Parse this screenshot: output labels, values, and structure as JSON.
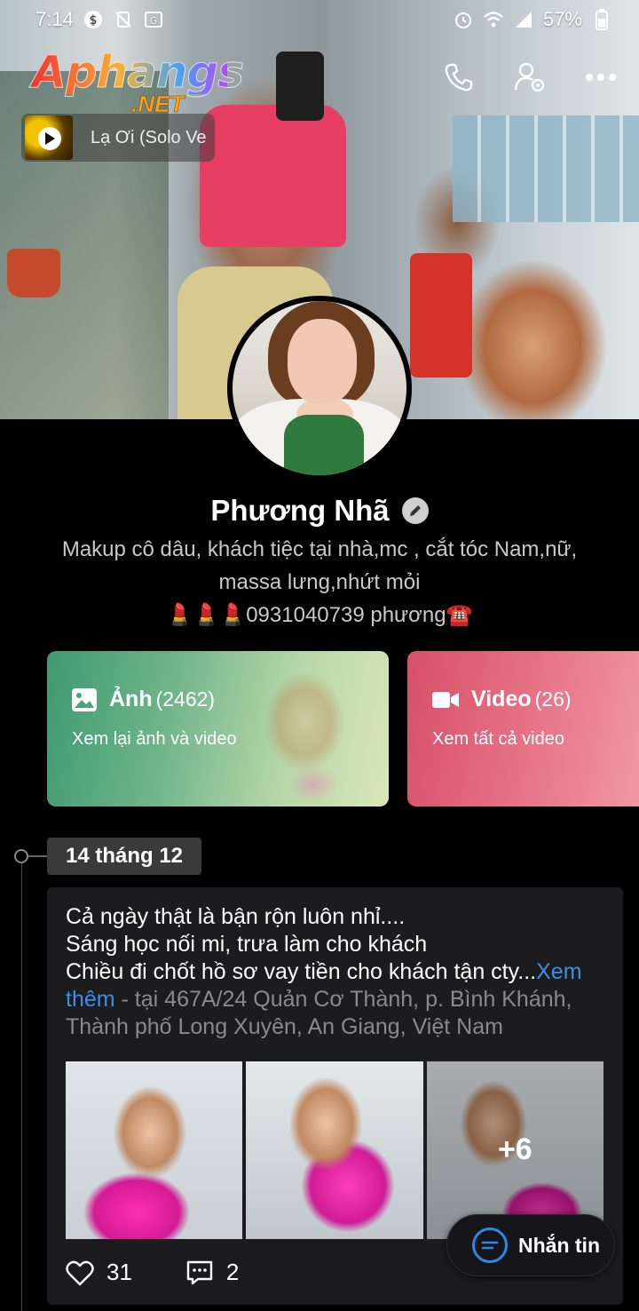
{
  "status_bar": {
    "time": "7:14",
    "battery": "57%"
  },
  "logo": {
    "main": "Aphangs",
    "sub": ".NET"
  },
  "music": {
    "title": "Lạ Ơi (Solo Ve"
  },
  "profile": {
    "name": "Phương Nhã",
    "bio_line1": "Makup cô dâu, khách tiệc tại nhà,mc , cắt tóc Nam,nữ,",
    "bio_line2": "massa lưng,nhứt mỏi",
    "bio_line3": "💄💄💄0931040739 phương☎️"
  },
  "cards": {
    "photos": {
      "title": "Ảnh",
      "count": "(2462)",
      "subtitle": "Xem lại ảnh và video",
      "color": "#3e9a70"
    },
    "video": {
      "title": "Video",
      "count": "(26)",
      "subtitle": "Xem tất cả video",
      "color": "#d84f6a"
    }
  },
  "timeline": {
    "date": "14 tháng 12"
  },
  "post": {
    "line1": "Cả ngày thật là bận rộn luôn nhỉ....",
    "line2": "Sáng học nối mi, trưa làm cho khách",
    "line3": "Chiều đi chốt hồ sơ vay tiền cho khách tận cty...",
    "see_more": "Xem thêm",
    "location": " - tại 467A/24 Quản Cơ Thành, p. Bình Khánh, Thành phố Long Xuyên, An Giang, Việt Nam",
    "more_photos": "+6",
    "likes": "31",
    "comments": "2"
  },
  "message_button": {
    "label": "Nhắn tin",
    "accent": "#2b8ae8"
  },
  "icons": {
    "call": "phone-icon",
    "settings": "user-settings-icon",
    "more": "more-dots-icon",
    "like": "heart-icon",
    "comment": "comment-icon"
  }
}
